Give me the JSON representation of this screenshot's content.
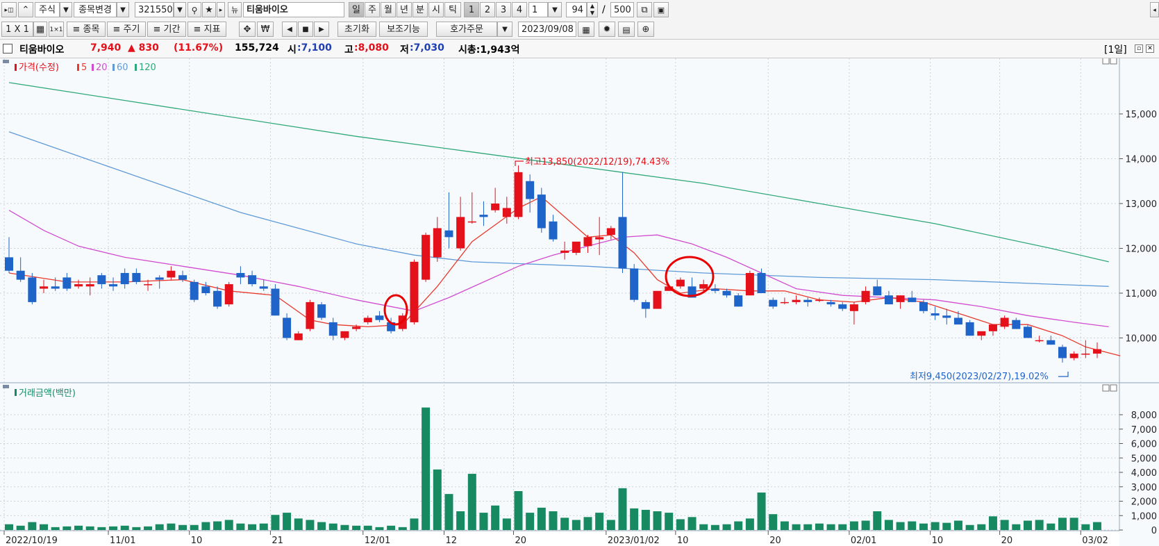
{
  "toolbar1": {
    "market": "주식",
    "change_stock": "종목변경",
    "code": "321550",
    "stock_name": "티움바이오",
    "period_tabs": [
      "일",
      "주",
      "월",
      "년",
      "분",
      "시",
      "틱"
    ],
    "number_tabs": [
      "1",
      "2",
      "3",
      "4"
    ],
    "interval_value": "1",
    "count_value": "94",
    "slash": "/",
    "count_max": "500"
  },
  "toolbar2": {
    "layout": "1 X 1",
    "btn_stock": "종목",
    "btn_period": "주기",
    "btn_range": "기간",
    "btn_indicator": "지표",
    "won_icon": "₩",
    "reset": "초기화",
    "aux": "보조기능",
    "order": "호가주문",
    "date": "2023/09/08"
  },
  "info": {
    "name": "티움바이오",
    "price": "7,940",
    "change": "▲ 830",
    "change_pct": "(11.67%)",
    "volume": "155,724",
    "open_label": "시",
    "open": ":7,100",
    "high_label": "고",
    "high": ":8,080",
    "low_label": "저",
    "low": ":7,030",
    "mcap": "시총:1,943억",
    "period_badge": "[1일]"
  },
  "colors": {
    "up": "#e4101a",
    "down": "#1f64c8",
    "ma5": "#e8392e",
    "ma20": "#d04cd0",
    "ma60": "#5e9ad8",
    "ma120": "#2ea878",
    "volume": "#178a62"
  },
  "chart_data": [
    {
      "type": "candlestick",
      "legend": {
        "price": "가격(수정)",
        "ma": [
          "5",
          "20",
          "60",
          "120"
        ]
      },
      "ylim": [
        9300,
        15500
      ],
      "yticks": [
        "15,000",
        "14,000",
        "13,000",
        "12,000",
        "11,000",
        "10,000"
      ],
      "x_labels": [
        {
          "i": 0,
          "t": "2022/10/19"
        },
        {
          "i": 9,
          "t": "11/01"
        },
        {
          "i": 16,
          "t": "10"
        },
        {
          "i": 23,
          "t": "21"
        },
        {
          "i": 31,
          "t": "12/01"
        },
        {
          "i": 38,
          "t": "12"
        },
        {
          "i": 44,
          "t": "20"
        },
        {
          "i": 52,
          "t": "2023/01/02"
        },
        {
          "i": 58,
          "t": "10"
        },
        {
          "i": 66,
          "t": "20"
        },
        {
          "i": 73,
          "t": "02/01"
        },
        {
          "i": 80,
          "t": "10"
        },
        {
          "i": 86,
          "t": "20"
        },
        {
          "i": 93,
          "t": "03/02"
        }
      ],
      "annotations": {
        "high": "최고13,850(2022/12/19),74.43%",
        "low": "최저9,450(2023/02/27),19.02%"
      },
      "candles": [
        [
          11800,
          12250,
          11450,
          11500
        ],
        [
          11500,
          11800,
          11250,
          11300
        ],
        [
          11350,
          11450,
          10750,
          10800
        ],
        [
          11100,
          11300,
          11000,
          11150
        ],
        [
          11150,
          11350,
          11050,
          11100
        ],
        [
          11350,
          11450,
          11050,
          11100
        ],
        [
          11150,
          11300,
          11100,
          11200
        ],
        [
          11150,
          11350,
          10950,
          11200
        ],
        [
          11400,
          11450,
          11100,
          11200
        ],
        [
          11200,
          11350,
          11050,
          11150
        ],
        [
          11450,
          11550,
          11100,
          11200
        ],
        [
          11450,
          11550,
          11200,
          11250
        ],
        [
          11200,
          11300,
          11050,
          11200
        ],
        [
          11350,
          11400,
          11100,
          11300
        ],
        [
          11350,
          11600,
          11300,
          11500
        ],
        [
          11400,
          11500,
          11250,
          11300
        ],
        [
          11250,
          11300,
          10800,
          10850
        ],
        [
          11150,
          11250,
          10950,
          11000
        ],
        [
          11050,
          11150,
          10650,
          10700
        ],
        [
          10750,
          11250,
          10700,
          11200
        ],
        [
          11450,
          11600,
          11200,
          11350
        ],
        [
          11400,
          11500,
          11150,
          11200
        ],
        [
          11150,
          11300,
          11050,
          11100
        ],
        [
          11100,
          11200,
          10500,
          10500
        ],
        [
          10450,
          10550,
          9950,
          10000
        ],
        [
          9950,
          10150,
          9950,
          10100
        ],
        [
          10200,
          10850,
          10150,
          10800
        ],
        [
          10750,
          10800,
          10400,
          10450
        ],
        [
          10350,
          10450,
          9950,
          10050
        ],
        [
          10000,
          10150,
          9950,
          10150
        ],
        [
          10200,
          10300,
          10150,
          10250
        ],
        [
          10350,
          10500,
          10300,
          10450
        ],
        [
          10500,
          10600,
          10350,
          10400
        ],
        [
          10350,
          10450,
          10100,
          10150
        ],
        [
          10200,
          10550,
          10150,
          10500
        ],
        [
          10350,
          11750,
          10300,
          11700
        ],
        [
          11300,
          12350,
          11250,
          12300
        ],
        [
          11800,
          12700,
          11700,
          12450
        ],
        [
          12400,
          13250,
          12000,
          12250
        ],
        [
          12000,
          13150,
          11950,
          12700
        ],
        [
          12600,
          13250,
          12550,
          12600
        ],
        [
          12750,
          13050,
          12500,
          12700
        ],
        [
          12850,
          13350,
          12800,
          13000
        ],
        [
          12700,
          13150,
          12550,
          12900
        ],
        [
          12700,
          13850,
          12650,
          13700
        ],
        [
          13500,
          13650,
          12800,
          13100
        ],
        [
          13200,
          13350,
          12350,
          12450
        ],
        [
          12600,
          12750,
          12150,
          12200
        ],
        [
          11900,
          12150,
          11750,
          11950
        ],
        [
          11900,
          12100,
          11850,
          12150
        ],
        [
          12050,
          12300,
          11900,
          12250
        ],
        [
          12200,
          12700,
          11850,
          12250
        ],
        [
          12300,
          12500,
          12200,
          12450
        ],
        [
          12700,
          13700,
          11450,
          11550
        ],
        [
          11550,
          11650,
          10800,
          10850
        ],
        [
          10800,
          10850,
          10450,
          10650
        ],
        [
          10650,
          11050,
          10650,
          11050
        ],
        [
          11050,
          11200,
          11050,
          11150
        ],
        [
          11150,
          11350,
          11100,
          11300
        ],
        [
          11150,
          11350,
          10900,
          10900
        ],
        [
          11100,
          11300,
          11050,
          11200
        ],
        [
          11100,
          11200,
          11000,
          11050
        ],
        [
          11050,
          11100,
          10900,
          10950
        ],
        [
          10950,
          11000,
          10700,
          10700
        ],
        [
          10950,
          11500,
          10950,
          11450
        ],
        [
          11450,
          11550,
          11000,
          11000
        ],
        [
          10850,
          10900,
          10650,
          10700
        ],
        [
          10800,
          10900,
          10750,
          10800
        ],
        [
          10800,
          10950,
          10750,
          10850
        ],
        [
          10850,
          10900,
          10700,
          10800
        ],
        [
          10850,
          10900,
          10800,
          10850
        ],
        [
          10800,
          10850,
          10700,
          10750
        ],
        [
          10750,
          10800,
          10600,
          10650
        ],
        [
          10600,
          10800,
          10300,
          10750
        ],
        [
          10800,
          11150,
          10750,
          11050
        ],
        [
          11150,
          11300,
          10950,
          10950
        ],
        [
          10950,
          11050,
          10750,
          10750
        ],
        [
          10800,
          10950,
          10650,
          10950
        ],
        [
          10900,
          11050,
          10800,
          10800
        ],
        [
          10800,
          10850,
          10550,
          10600
        ],
        [
          10550,
          10700,
          10400,
          10500
        ],
        [
          10500,
          10650,
          10300,
          10450
        ],
        [
          10450,
          10600,
          10350,
          10300
        ],
        [
          10350,
          10400,
          10050,
          10050
        ],
        [
          10050,
          10150,
          9950,
          10150
        ],
        [
          10150,
          10300,
          10050,
          10300
        ],
        [
          10250,
          10500,
          10200,
          10450
        ],
        [
          10400,
          10450,
          10200,
          10200
        ],
        [
          10250,
          10300,
          10000,
          10000
        ],
        [
          9950,
          10050,
          9900,
          9950
        ],
        [
          9950,
          10050,
          9850,
          9850
        ],
        [
          9800,
          9850,
          9450,
          9550
        ],
        [
          9550,
          9700,
          9500,
          9650
        ],
        [
          9650,
          9950,
          9550,
          9650
        ],
        [
          9650,
          9900,
          9550,
          9750
        ]
      ],
      "ma5": [
        [
          0,
          11450
        ],
        [
          5,
          11250
        ],
        [
          10,
          11250
        ],
        [
          15,
          11300
        ],
        [
          19,
          11050
        ],
        [
          23,
          10950
        ],
        [
          26,
          10400
        ],
        [
          28,
          10300
        ],
        [
          31,
          10250
        ],
        [
          34,
          10300
        ],
        [
          37,
          11150
        ],
        [
          40,
          12150
        ],
        [
          44,
          12900
        ],
        [
          46,
          13150
        ],
        [
          48,
          12700
        ],
        [
          50,
          12250
        ],
        [
          52,
          12300
        ],
        [
          54,
          11900
        ],
        [
          56,
          11300
        ],
        [
          58,
          11000
        ],
        [
          61,
          11100
        ],
        [
          64,
          11050
        ],
        [
          67,
          11050
        ],
        [
          70,
          10850
        ],
        [
          73,
          10800
        ],
        [
          76,
          10900
        ],
        [
          79,
          10800
        ],
        [
          82,
          10550
        ],
        [
          85,
          10300
        ],
        [
          88,
          10300
        ],
        [
          91,
          10050
        ],
        [
          93,
          9800
        ],
        [
          96,
          9600
        ]
      ],
      "ma20": [
        [
          0,
          12850
        ],
        [
          3,
          12400
        ],
        [
          6,
          12050
        ],
        [
          10,
          11800
        ],
        [
          15,
          11600
        ],
        [
          20,
          11400
        ],
        [
          25,
          11150
        ],
        [
          30,
          10850
        ],
        [
          35,
          10600
        ],
        [
          38,
          10900
        ],
        [
          41,
          11250
        ],
        [
          44,
          11600
        ],
        [
          47,
          11850
        ],
        [
          50,
          12050
        ],
        [
          53,
          12250
        ],
        [
          56,
          12300
        ],
        [
          59,
          12100
        ],
        [
          62,
          11800
        ],
        [
          65,
          11450
        ],
        [
          68,
          11100
        ],
        [
          72,
          10950
        ],
        [
          76,
          10900
        ],
        [
          80,
          10850
        ],
        [
          84,
          10700
        ],
        [
          88,
          10500
        ],
        [
          92,
          10350
        ],
        [
          95,
          10250
        ]
      ],
      "ma60": [
        [
          0,
          14600
        ],
        [
          10,
          13700
        ],
        [
          20,
          12800
        ],
        [
          30,
          12100
        ],
        [
          35,
          11850
        ],
        [
          40,
          11700
        ],
        [
          50,
          11600
        ],
        [
          60,
          11450
        ],
        [
          70,
          11350
        ],
        [
          80,
          11300
        ],
        [
          90,
          11200
        ],
        [
          95,
          11150
        ]
      ],
      "ma120": [
        [
          0,
          15700
        ],
        [
          10,
          15300
        ],
        [
          20,
          14900
        ],
        [
          30,
          14500
        ],
        [
          40,
          14150
        ],
        [
          50,
          13800
        ],
        [
          60,
          13450
        ],
        [
          70,
          13000
        ],
        [
          80,
          12550
        ],
        [
          90,
          12000
        ],
        [
          95,
          11700
        ]
      ]
    },
    {
      "type": "bar",
      "legend": "거래금액(백만)",
      "ylim": [
        0,
        9000
      ],
      "yticks": [
        "8,000",
        "7,000",
        "6,000",
        "5,000",
        "4,000",
        "3,000",
        "2,000",
        "1,000",
        "0"
      ],
      "values": [
        400,
        300,
        550,
        400,
        200,
        250,
        300,
        250,
        200,
        250,
        300,
        200,
        250,
        400,
        450,
        350,
        350,
        550,
        600,
        700,
        450,
        400,
        450,
        1050,
        1200,
        800,
        700,
        550,
        450,
        350,
        300,
        300,
        200,
        300,
        200,
        800,
        8500,
        4200,
        2500,
        1300,
        3900,
        1200,
        1700,
        800,
        2700,
        1200,
        1550,
        1300,
        850,
        700,
        900,
        1200,
        700,
        2900,
        1500,
        1400,
        1300,
        1200,
        750,
        900,
        400,
        350,
        400,
        600,
        800,
        2600,
        1100,
        600,
        400,
        400,
        450,
        400,
        400,
        600,
        650,
        1300,
        700,
        550,
        600,
        450,
        550,
        500,
        650,
        350,
        400,
        950,
        700,
        400,
        650,
        700,
        450,
        850,
        850,
        400,
        550
      ]
    }
  ]
}
